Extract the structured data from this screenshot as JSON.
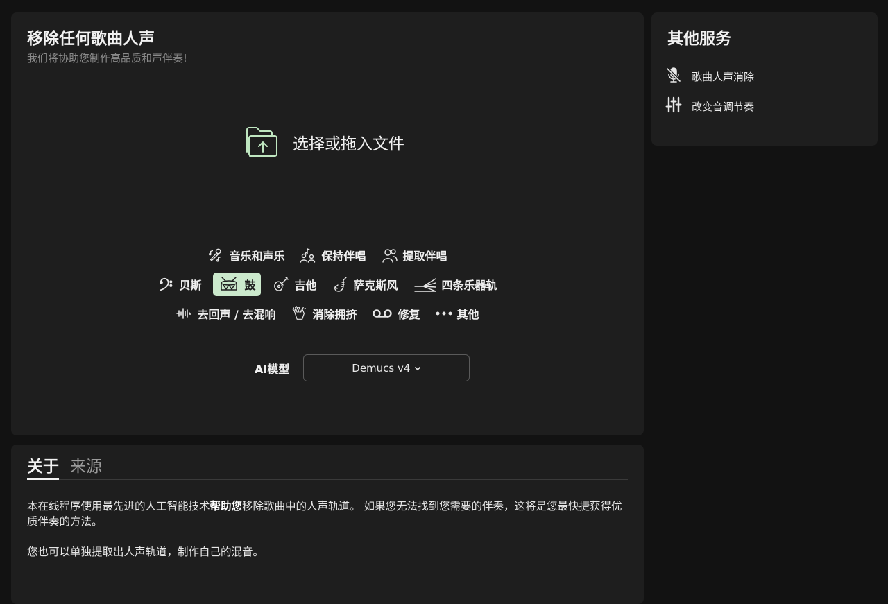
{
  "main": {
    "title": "移除任何歌曲人声",
    "subtitle": "我们将协助您制作高品质和声伴奏!",
    "upload_label": "选择或拖入文件",
    "options_row1": [
      {
        "label": "音乐和声乐",
        "icon": "microphone-note-icon"
      },
      {
        "label": "保持伴唱",
        "icon": "choir-icon"
      },
      {
        "label": "提取伴唱",
        "icon": "singers-icon"
      }
    ],
    "options_row2": [
      {
        "label": "贝斯",
        "icon": "bass-clef-icon"
      },
      {
        "label": "鼓",
        "icon": "drum-icon",
        "selected": true
      },
      {
        "label": "吉他",
        "icon": "guitar-icon"
      },
      {
        "label": "萨克斯风",
        "icon": "saxophone-icon"
      },
      {
        "label": "四条乐器轨",
        "icon": "split-tracks-icon"
      }
    ],
    "options_row3": [
      {
        "label": "去回声 / 去混响",
        "icon": "waveform-icon"
      },
      {
        "label": "消除拥挤",
        "icon": "clapping-hands-icon"
      },
      {
        "label": "修复",
        "icon": "voicemail-icon"
      },
      {
        "label": "其他",
        "icon": "more-dots-icon"
      }
    ],
    "model_label": "AI模型",
    "model_value": "Demucs v4"
  },
  "side": {
    "title": "其他服务",
    "items": [
      {
        "label": "歌曲人声消除",
        "icon": "mic-off-icon"
      },
      {
        "label": "改变音调节奏",
        "icon": "sliders-icon"
      }
    ]
  },
  "about": {
    "tabs": [
      "关于",
      "来源"
    ],
    "para1_a": "本在线程序使用最先进的人工智能技术",
    "para1_bold": "帮助您",
    "para1_b": "移除歌曲中的人声轨道。 如果您无法找到您需要的伴奏，这将是您最快捷获得优质伴奏的方法。",
    "para2": "您也可以单独提取出人声轨道，制作自己的混音。"
  },
  "colors": {
    "accent": "#cbe9cc",
    "background": "#121212",
    "card": "#1e1e1e"
  }
}
